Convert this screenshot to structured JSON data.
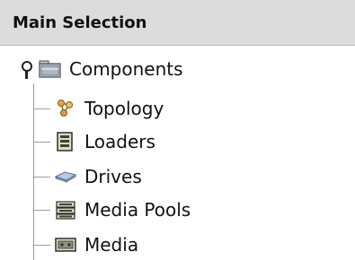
{
  "panel": {
    "title": "Main Selection"
  },
  "tree": {
    "root": {
      "label": "Components",
      "icon": "folder-icon",
      "expanded": true
    },
    "children": [
      {
        "label": "Topology",
        "icon": "topology-icon"
      },
      {
        "label": "Loaders",
        "icon": "loader-icon"
      },
      {
        "label": "Drives",
        "icon": "drive-icon"
      },
      {
        "label": "Media Pools",
        "icon": "media-pool-icon"
      },
      {
        "label": "Media",
        "icon": "media-icon"
      }
    ]
  },
  "colors": {
    "header_bg": "#dcdcdc",
    "tree_line": "#9e9e9e",
    "text": "#111111"
  }
}
